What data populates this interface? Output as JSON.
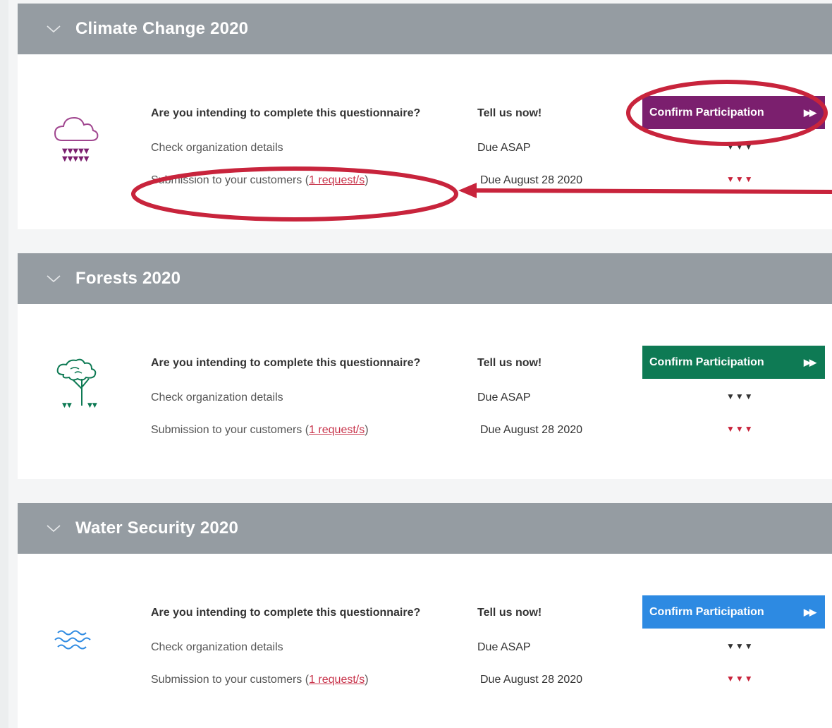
{
  "colors": {
    "header": "#959ca2",
    "climate": "#7b1f6e",
    "forests": "#0e7a54",
    "water": "#2d8ae2",
    "annotation": "#c8243c"
  },
  "sections": [
    {
      "title": "Climate Change 2020",
      "icon": "cloud-rain-icon",
      "question": "Are you intending to complete this questionnaire?",
      "tell": "Tell us now!",
      "check_label": "Check organization details",
      "check_due": "Due ASAP",
      "sub_prefix": "Submission to your customers (",
      "sub_link": "1 request/s",
      "sub_suffix": ")",
      "sub_due": "Due August 28 2020",
      "button_label": "Confirm Participation",
      "button_arrows": "▶▶",
      "dots": "▼▼▼"
    },
    {
      "title": "Forests 2020",
      "icon": "tree-icon",
      "question": "Are you intending to complete this questionnaire?",
      "tell": "Tell us now!",
      "check_label": "Check organization details",
      "check_due": "Due ASAP",
      "sub_prefix": "Submission to your customers (",
      "sub_link": "1 request/s",
      "sub_suffix": ")",
      "sub_due": "Due August 28 2020",
      "button_label": "Confirm Participation",
      "button_arrows": "▶▶",
      "dots": "▼▼▼"
    },
    {
      "title": "Water Security 2020",
      "icon": "water-waves-icon",
      "question": "Are you intending to complete this questionnaire?",
      "tell": "Tell us now!",
      "check_label": "Check organization details",
      "check_due": "Due ASAP",
      "sub_prefix": "Submission to your customers (",
      "sub_link": "1 request/s",
      "sub_suffix": ")",
      "sub_due": "Due August 28 2020",
      "button_label": "Confirm Participation",
      "button_arrows": "▶▶",
      "dots": "▼▼▼"
    }
  ]
}
